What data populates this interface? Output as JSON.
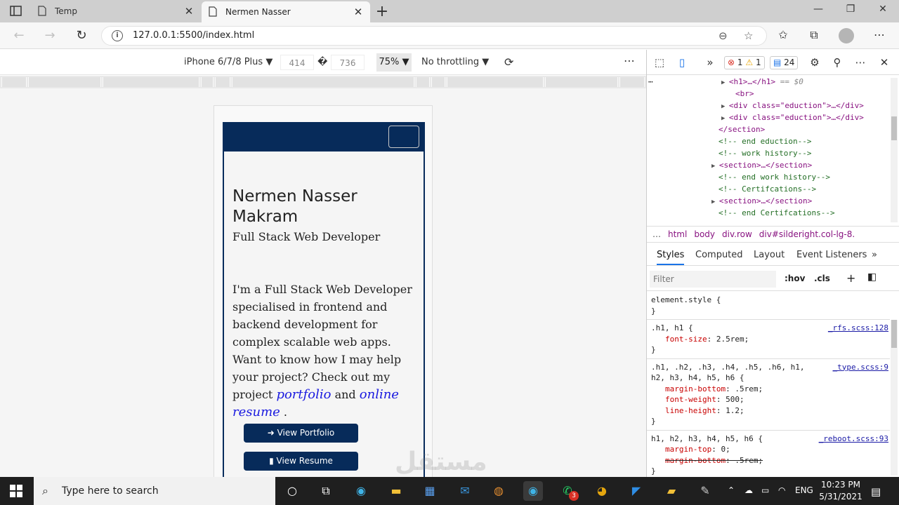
{
  "browser": {
    "tabs": [
      {
        "title": "Temp",
        "active": false
      },
      {
        "title": "Nermen Nasser",
        "active": true
      }
    ],
    "url": "127.0.0.1:5500/index.html"
  },
  "device_toolbar": {
    "device": "iPhone 6/7/8 Plus",
    "width": "414",
    "separator": "�",
    "height": "736",
    "zoom": "75%",
    "throttling": "No throttling"
  },
  "site": {
    "name": "Nermen Nasser Makram",
    "role": "Full Stack Web Developer",
    "bio_before": "I'm a Full Stack Web Developer specialised in frontend and backend development for complex scalable web apps. Want to know how I may help your project? Check out my project",
    "link_portfolio": "portfolio",
    "bio_and": "and",
    "link_resume": "online resume",
    "bio_end": ".",
    "btn_portfolio": "View Portfolio",
    "btn_resume": "View Resume"
  },
  "watermark": "مستقل",
  "devtools": {
    "errors": "1",
    "warnings": "1",
    "messages": "24",
    "dom_lines": [
      {
        "indent": 106,
        "tri": "▶",
        "html": "<h1>…</h1>",
        "extra": " == $0"
      },
      {
        "indent": 126,
        "tri": "",
        "html": "<br>",
        "extra": ""
      },
      {
        "indent": 106,
        "tri": "▶",
        "html": "<div class=\"eduction\">…</div>",
        "extra": ""
      },
      {
        "indent": 106,
        "tri": "▶",
        "html": "<div class=\"eduction\">…</div>",
        "extra": ""
      },
      {
        "indent": 102,
        "tri": "",
        "html": "</section>",
        "extra": ""
      },
      {
        "indent": 102,
        "tri": "",
        "comment": "<!-- end eduction-->"
      },
      {
        "indent": 102,
        "tri": "",
        "comment": "<!--  work history-->"
      },
      {
        "indent": 92,
        "tri": "▶",
        "html": "<section>…</section>",
        "extra": ""
      },
      {
        "indent": 102,
        "tri": "",
        "comment": "<!-- end work history-->"
      },
      {
        "indent": 102,
        "tri": "",
        "comment": "<!-- Certifcations-->"
      },
      {
        "indent": 92,
        "tri": "▶",
        "html": "<section>…</section>",
        "extra": ""
      },
      {
        "indent": 102,
        "tri": "",
        "comment": "<!-- end Certifcations-->"
      }
    ],
    "breadcrumbs": [
      "…",
      "html",
      "body",
      "div.row",
      "div#silderight.col-lg-8."
    ],
    "style_tabs": [
      "Styles",
      "Computed",
      "Layout",
      "Event Listeners"
    ],
    "filter_placeholder": "Filter",
    "hov": ":hov",
    "cls": ".cls",
    "rules": [
      {
        "selector": "element.style {",
        "source": "",
        "props": []
      },
      {
        "selector": ".h1, h1 {",
        "source": "_rfs.scss:128",
        "props": [
          {
            "name": "font-size",
            "value": "2.5rem;",
            "struck": false
          }
        ]
      },
      {
        "selector": ".h1, .h2, .h3, .h4, .h5, .h6, h1, h2, h3, h4, h5, h6 {",
        "source": "_type.scss:9",
        "props": [
          {
            "name": "margin-bottom",
            "value": ".5rem;",
            "struck": false
          },
          {
            "name": "font-weight",
            "value": "500;",
            "struck": false
          },
          {
            "name": "line-height",
            "value": "1.2;",
            "struck": false
          }
        ]
      },
      {
        "selector": "h1, h2, h3, h4, h5, h6 {",
        "source": "_reboot.scss:93",
        "props": [
          {
            "name": "margin-top",
            "value": "0;",
            "struck": false
          },
          {
            "name": "margin-bottom",
            "value": ".5rem;",
            "struck": true
          }
        ]
      }
    ]
  },
  "taskbar": {
    "search_placeholder": "Type here to search",
    "language": "ENG",
    "time": "10:23 PM",
    "date": "5/31/2021",
    "whatsapp_badge": "3"
  }
}
